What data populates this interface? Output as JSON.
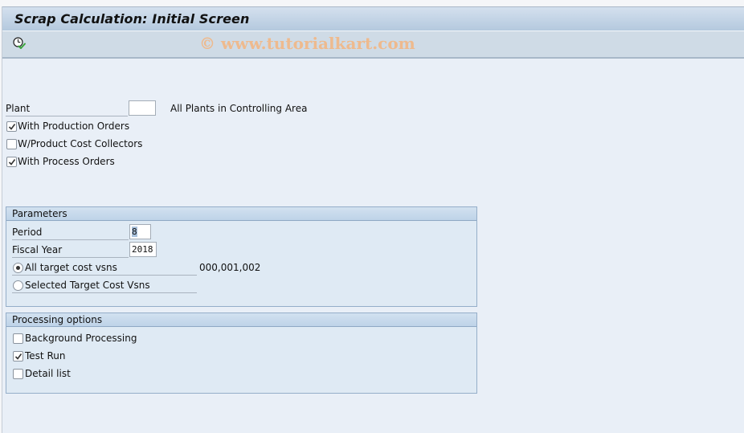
{
  "window": {
    "title": "Scrap Calculation: Initial Screen"
  },
  "toolbar": {
    "execute_icon": "execute-clock-check-icon",
    "watermark": "© www.tutorialkart.com"
  },
  "selection": {
    "plant_label": "Plant",
    "plant_value": "",
    "plant_description": "All Plants in Controlling Area",
    "options": [
      {
        "label": "With Production Orders",
        "checked": true
      },
      {
        "label": "W/Product Cost Collectors",
        "checked": false
      },
      {
        "label": "With Process Orders",
        "checked": true
      }
    ]
  },
  "parameters": {
    "title": "Parameters",
    "period_label": "Period",
    "period_value": "8",
    "fiscal_year_label": "Fiscal Year",
    "fiscal_year_value": "2018",
    "radios": [
      {
        "label": "All target cost vsns",
        "selected": true,
        "value_text": "000,001,002"
      },
      {
        "label": "Selected Target Cost Vsns",
        "selected": false,
        "value_text": ""
      }
    ]
  },
  "processing": {
    "title": "Processing options",
    "options": [
      {
        "label": "Background Processing",
        "checked": false
      },
      {
        "label": "Test Run",
        "checked": true
      },
      {
        "label": "Detail list",
        "checked": false
      }
    ]
  },
  "colors": {
    "title_bar": "#b4c9de",
    "toolbar": "#cfdbe6",
    "background": "#e9eff7",
    "group_border": "#95aec9",
    "watermark": "#f0b98a"
  }
}
